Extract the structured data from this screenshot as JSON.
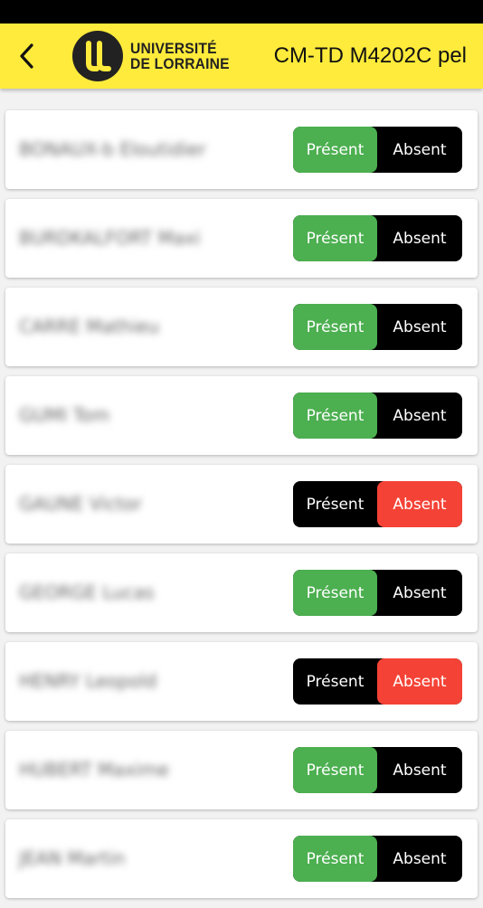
{
  "header": {
    "back_icon": "chevron-left-icon",
    "logo_line1": "UNIVERSITÉ",
    "logo_line2": "DE LORRAINE",
    "title": "CM-TD M4202C pel"
  },
  "colors": {
    "header_bg": "#ffeb3b",
    "present_active": "#4caf50",
    "absent_active": "#f44336",
    "toggle_inactive": "#000000"
  },
  "toggle_labels": {
    "present": "Présent",
    "absent": "Absent"
  },
  "students": [
    {
      "name": "BONAUX-b Eloutidier",
      "status": "present"
    },
    {
      "name": "BURDKALFORT Maxi",
      "status": "present"
    },
    {
      "name": "CARRE Mathieu",
      "status": "present"
    },
    {
      "name": "GUMI Tom",
      "status": "present"
    },
    {
      "name": "GAUNE Victor",
      "status": "absent"
    },
    {
      "name": "GEORGE Lucas",
      "status": "present"
    },
    {
      "name": "HENRY Leopold",
      "status": "absent"
    },
    {
      "name": "HUBERT Maxime",
      "status": "present"
    },
    {
      "name": "JEAN Martin",
      "status": "present"
    }
  ]
}
